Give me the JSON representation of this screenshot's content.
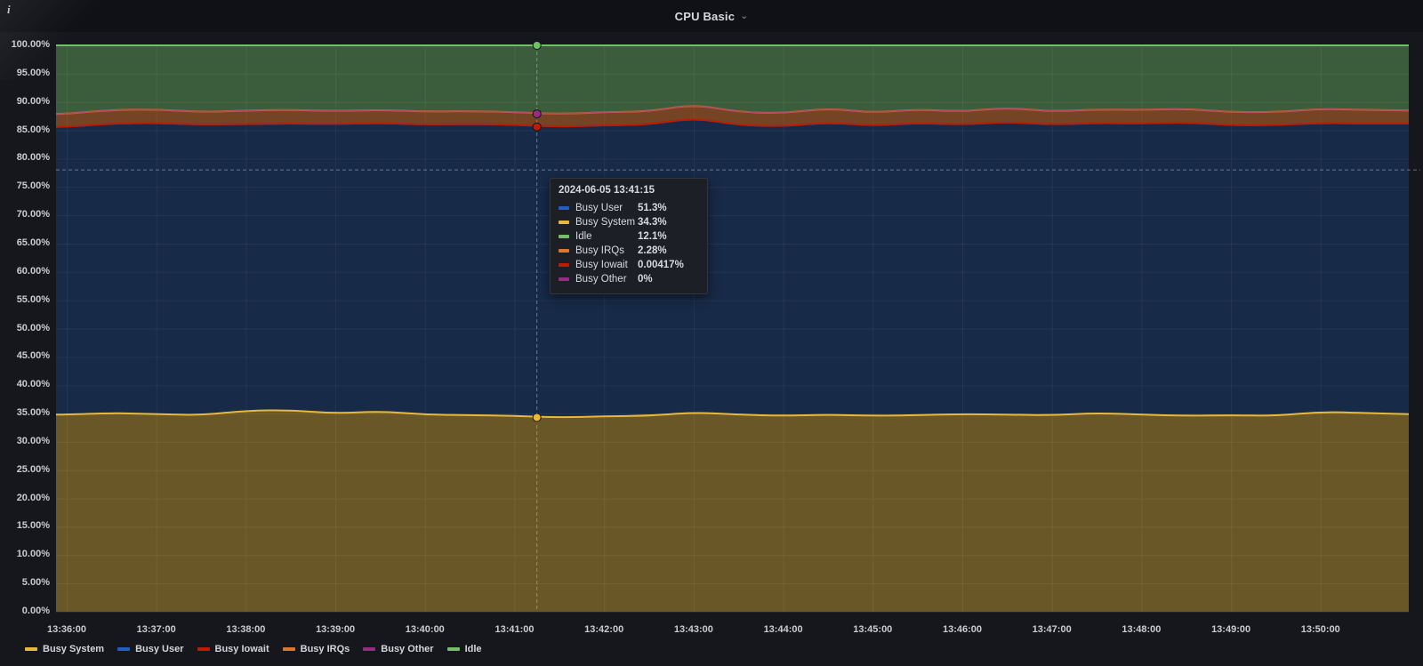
{
  "panel": {
    "title": "CPU Basic",
    "icons": {
      "info": "i",
      "chevron_down": "⌄"
    }
  },
  "legend": {
    "items": [
      "Busy System",
      "Busy User",
      "Busy Iowait",
      "Busy IRQs",
      "Busy Other",
      "Idle"
    ]
  },
  "tooltip": {
    "title": "2024-06-05 13:41:15",
    "rows": [
      {
        "series": "Busy User",
        "value": "51.3%"
      },
      {
        "series": "Busy System",
        "value": "34.3%"
      },
      {
        "series": "Idle",
        "value": "12.1%"
      },
      {
        "series": "Busy IRQs",
        "value": "2.28%"
      },
      {
        "series": "Busy Iowait",
        "value": "0.00417%"
      },
      {
        "series": "Busy Other",
        "value": "0%"
      }
    ]
  },
  "chart_data": {
    "type": "area",
    "stacked": true,
    "unit": "percent",
    "ylim": [
      0,
      100
    ],
    "y_tick_step": 5,
    "y_ticks": [
      "0.00%",
      "5.00%",
      "10.00%",
      "15.00%",
      "20.00%",
      "25.00%",
      "30.00%",
      "35.00%",
      "40.00%",
      "45.00%",
      "50.00%",
      "55.00%",
      "60.00%",
      "65.00%",
      "70.00%",
      "75.00%",
      "80.00%",
      "85.00%",
      "90.00%",
      "95.00%",
      "100.00%"
    ],
    "x_ticks": [
      "13:36:00",
      "13:37:00",
      "13:38:00",
      "13:39:00",
      "13:40:00",
      "13:41:00",
      "13:42:00",
      "13:43:00",
      "13:44:00",
      "13:45:00",
      "13:46:00",
      "13:47:00",
      "13:48:00",
      "13:49:00",
      "13:50:00"
    ],
    "x_start": "13:36:00",
    "x_step_seconds": 30,
    "grid": true,
    "legend_position": "bottom",
    "series": [
      {
        "name": "Busy System",
        "color": "#EAB839",
        "fill_opacity": 0.4,
        "values": [
          34.8,
          35.1,
          34.9,
          34.7,
          35.5,
          35.6,
          35.0,
          35.4,
          34.8,
          34.7,
          34.6,
          34.3,
          34.5,
          34.6,
          35.2,
          34.8,
          34.6,
          34.8,
          34.6,
          34.7,
          34.9,
          34.8,
          34.7,
          35.1,
          34.8,
          34.6,
          34.7,
          34.6,
          35.3,
          35.1,
          34.9
        ]
      },
      {
        "name": "Busy User",
        "color": "#1F60C4",
        "fill_opacity": 0.26,
        "values": [
          50.8,
          51.1,
          51.4,
          51.3,
          50.6,
          50.6,
          51.1,
          50.9,
          51.2,
          51.4,
          51.4,
          51.3,
          51.4,
          51.4,
          52.0,
          51.1,
          51.1,
          51.6,
          51.2,
          51.6,
          51.1,
          51.7,
          51.3,
          51.2,
          51.4,
          51.8,
          51.2,
          51.3,
          51.0,
          51.1,
          51.3
        ]
      },
      {
        "name": "Busy Iowait",
        "color": "#BF1B00",
        "fill_opacity": 0.3,
        "values": [
          0.004,
          0.004,
          0.004,
          0.004,
          0.004,
          0.004,
          0.004,
          0.004,
          0.004,
          0.004,
          0.004,
          0.004,
          0.004,
          0.004,
          0.004,
          0.004,
          0.004,
          0.004,
          0.004,
          0.004,
          0.004,
          0.004,
          0.004,
          0.004,
          0.004,
          0.004,
          0.004,
          0.004,
          0.004,
          0.004,
          0.004
        ]
      },
      {
        "name": "Busy IRQs",
        "color": "#E0752D",
        "fill_opacity": 0.48,
        "values": [
          2.3,
          2.4,
          2.4,
          2.2,
          2.4,
          2.4,
          2.3,
          2.3,
          2.3,
          2.3,
          2.2,
          2.28,
          2.3,
          2.3,
          2.4,
          2.3,
          2.3,
          2.5,
          2.3,
          2.4,
          2.3,
          2.5,
          2.3,
          2.4,
          2.4,
          2.4,
          2.3,
          2.3,
          2.5,
          2.4,
          2.3
        ]
      },
      {
        "name": "Busy Other",
        "color": "#962D82",
        "fill_opacity": 0.3,
        "values": [
          0,
          0,
          0,
          0,
          0,
          0,
          0,
          0,
          0,
          0,
          0,
          0,
          0,
          0,
          0,
          0,
          0,
          0,
          0,
          0,
          0,
          0,
          0,
          0,
          0,
          0,
          0,
          0,
          0,
          0,
          0
        ]
      },
      {
        "name": "Idle",
        "color": "#73BF69",
        "fill_opacity": 0.42,
        "values": [
          12.1,
          11.4,
          11.3,
          11.8,
          11.5,
          11.4,
          11.6,
          11.4,
          11.7,
          11.6,
          11.8,
          12.1,
          11.8,
          11.7,
          10.4,
          11.8,
          12.0,
          11.1,
          11.9,
          11.3,
          11.7,
          11.0,
          11.7,
          11.3,
          11.4,
          11.2,
          11.8,
          11.8,
          11.2,
          11.4,
          11.5
        ]
      }
    ],
    "crosshair": {
      "time_label": "13:41:15",
      "x_minutes_from_start": 5.25,
      "y_percent": 78,
      "dots": [
        {
          "series": "Busy System",
          "cum": 34.3
        },
        {
          "series": "Busy User",
          "cum": 85.6
        },
        {
          "series": "Busy Iowait",
          "cum": 85.6
        },
        {
          "series": "Busy IRQs",
          "cum": 87.9
        },
        {
          "series": "Busy Other",
          "cum": 87.9
        },
        {
          "series": "Idle",
          "cum": 100
        }
      ]
    }
  },
  "colors": {
    "panel_bg": "#15171c",
    "header_bg": "#0f1116",
    "grid": "rgba(255,255,255,0.07)",
    "crosshair": "rgba(170,186,201,0.55)",
    "tooltip_bg": "#1c1f26",
    "axis_text": "#c9ccd1"
  }
}
